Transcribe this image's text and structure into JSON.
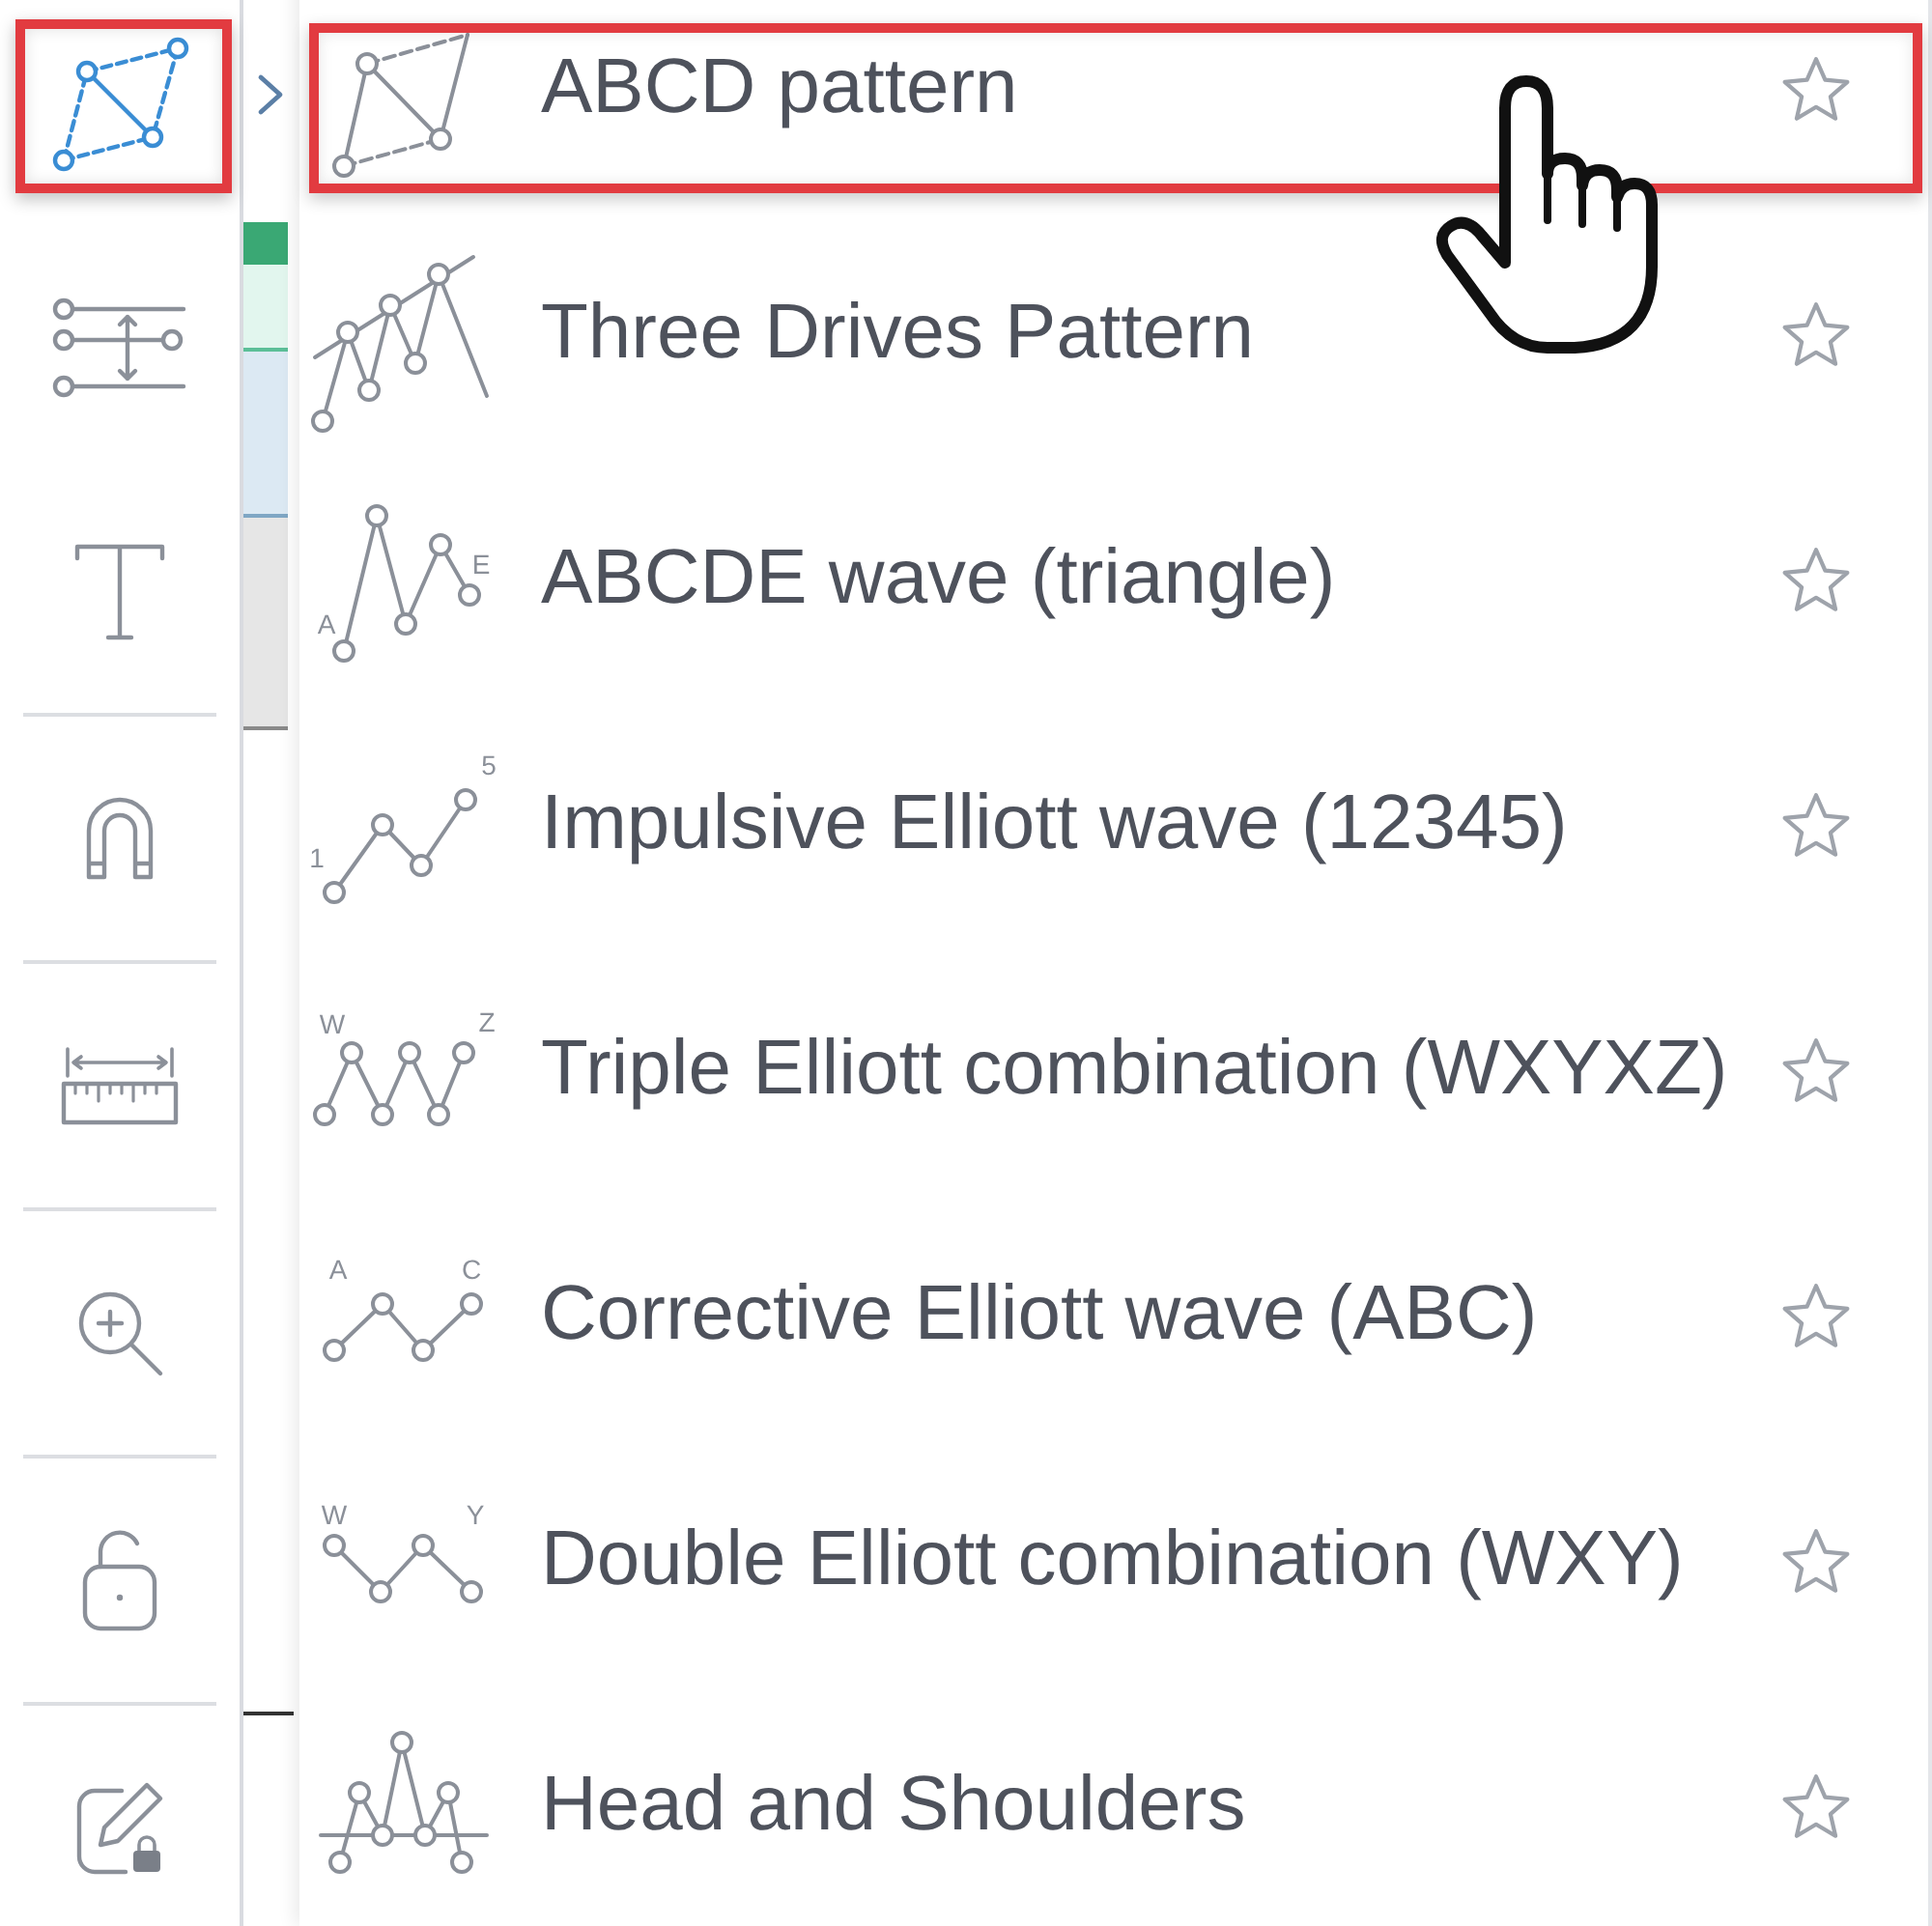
{
  "toolbar": {
    "groups": [
      {
        "tools": [
          {
            "selected": true,
            "highlighted": true
          },
          {
            "selected": false,
            "highlighted": false
          },
          {
            "selected": false,
            "highlighted": false
          }
        ]
      },
      {
        "tools": [
          {
            "selected": false,
            "highlighted": false
          }
        ]
      },
      {
        "tools": [
          {
            "selected": false,
            "highlighted": false
          }
        ]
      },
      {
        "tools": [
          {
            "selected": false,
            "highlighted": false
          }
        ]
      },
      {
        "tools": [
          {
            "selected": false,
            "highlighted": false
          }
        ]
      },
      {
        "tools": [
          {
            "selected": false,
            "highlighted": false
          }
        ]
      }
    ]
  },
  "menu": {
    "items": [
      {
        "label": "ABCD pattern",
        "highlighted": true,
        "favorite": false
      },
      {
        "label": "Three Drives Pattern",
        "highlighted": false,
        "favorite": false
      },
      {
        "label": "ABCDE wave (triangle)",
        "highlighted": false,
        "favorite": false,
        "icon_labels": [
          "A",
          "E"
        ]
      },
      {
        "label": "Impulsive Elliott wave (12345)",
        "highlighted": false,
        "favorite": false,
        "icon_labels": [
          "1",
          "5"
        ]
      },
      {
        "label": "Triple Elliott combination (WXYXZ)",
        "highlighted": false,
        "favorite": false,
        "icon_labels": [
          "W",
          "Z"
        ]
      },
      {
        "label": "Corrective Elliott wave (ABC)",
        "highlighted": false,
        "favorite": false,
        "icon_labels": [
          "A",
          "C"
        ]
      },
      {
        "label": "Double Elliott combination (WXY)",
        "highlighted": false,
        "favorite": false,
        "icon_labels": [
          "W",
          "Y"
        ]
      },
      {
        "label": "Head and Shoulders",
        "highlighted": false,
        "favorite": false
      }
    ]
  }
}
